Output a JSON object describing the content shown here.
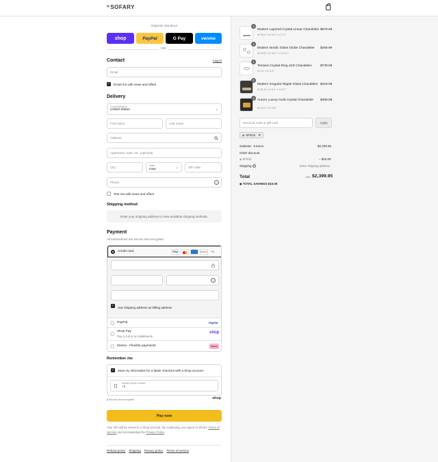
{
  "header": {
    "brand": "SOFARY",
    "brand_prefix": "ᵂ"
  },
  "express": {
    "label": "Express checkout",
    "or": "OR",
    "buttons": [
      {
        "label": "shop",
        "color": "#5a31f4",
        "text": "#ffffff"
      },
      {
        "label": "PayPal",
        "color": "#ffc439",
        "text": "#003087"
      },
      {
        "label": "G Pay",
        "color": "#000000",
        "text": "#ffffff"
      },
      {
        "label": "venmo",
        "color": "#008cff",
        "text": "#ffffff"
      }
    ]
  },
  "contact": {
    "title": "Contact",
    "login": "Log in",
    "email_placeholder": "Email",
    "news_label": "Email me with news and offers"
  },
  "delivery": {
    "title": "Delivery",
    "country_label": "Country/Region",
    "country_value": "United States",
    "first_name": "First name",
    "last_name": "Last name",
    "address": "Address",
    "apartment": "Apartment, suite, etc. (optional)",
    "city": "City",
    "state_label": "State",
    "state_value": "Iowa",
    "zip": "ZIP code",
    "phone": "Phone",
    "text_offers": "Text me with news and offers"
  },
  "shipping_method": {
    "title": "Shipping method",
    "message": "Enter your shipping address to view available shipping methods."
  },
  "payment": {
    "title": "Payment",
    "subtitle": "All transactions are secure and encrypted.",
    "credit_card": "Credit card",
    "more_cards": "+5",
    "billing_label": "Use shipping address as billing address",
    "paypal": "PayPal",
    "paypal_logo": "PayPal",
    "shoppay": "Shop Pay",
    "shoppay_sub": "Pay in full or in installments",
    "shoppay_logo": "shop",
    "klarna": "Klarna - Flexible payments",
    "klarna_logo": "Klarna"
  },
  "remember": {
    "title": "Remember me",
    "save_label": "Save my information for a faster checkout with a Shop account",
    "mobile_label": "Mobile phone number",
    "mobile_value": "+1",
    "secure": "Secure and encrypted",
    "shop_logo": "shop"
  },
  "pay": {
    "button": "Pay now",
    "note_before": "Your info will be saved to a Shop account. By continuing, you agree to Shop's",
    "terms": "Terms of Service",
    "note_mid": "and acknowledge the",
    "privacy": "Privacy Policy",
    "note_end": "."
  },
  "footer": {
    "links": [
      "Refund policy",
      "Shipping",
      "Privacy policy",
      "Terms of service"
    ]
  },
  "cart": {
    "items": [
      {
        "qty": "1",
        "name": "Modern Layered Crystal Linear Chandelier",
        "variant": "W 35.4\" x D 6.3\" x H 7.1\"",
        "price": "$579.99"
      },
      {
        "qty": "1",
        "name": "Modern Nordic Glass Globe Chandelier",
        "variant": "W 33.5\" x D 16.7\" x H 15.7\"",
        "price": "$269.99"
      },
      {
        "qty": "1",
        "name": "Tessera Crystal Ring LED Chandelier",
        "variant": "W 24\" x H 3.9\"",
        "price": "$739.99"
      },
      {
        "qty": "1",
        "name": "Modern Irregular Ripple Glass Chandelier",
        "variant": "W 31.5\" x D 5.1\" x H 6.7\"",
        "price": "$419.99"
      },
      {
        "qty": "1",
        "name": "Aurum Luxury Gold Crystal Chandelier",
        "variant": "W 19.7\" x H 9.8\"",
        "price": "$399.99"
      }
    ],
    "discount_placeholder": "Discount code or gift card",
    "apply": "Apply",
    "tag": "SFR10",
    "subtotal_label": "Subtotal · 5 items",
    "subtotal_value": "$2,409.95",
    "order_discount": "Order discount",
    "discount_code": "SFR10",
    "discount_value": "– $10.00",
    "shipping_label": "Shipping",
    "shipping_value": "Enter shipping address",
    "total_label": "Total",
    "currency": "USD",
    "total_value": "$2,399.95",
    "savings_label": "TOTAL SAVINGS",
    "savings_value": "$10.00"
  }
}
